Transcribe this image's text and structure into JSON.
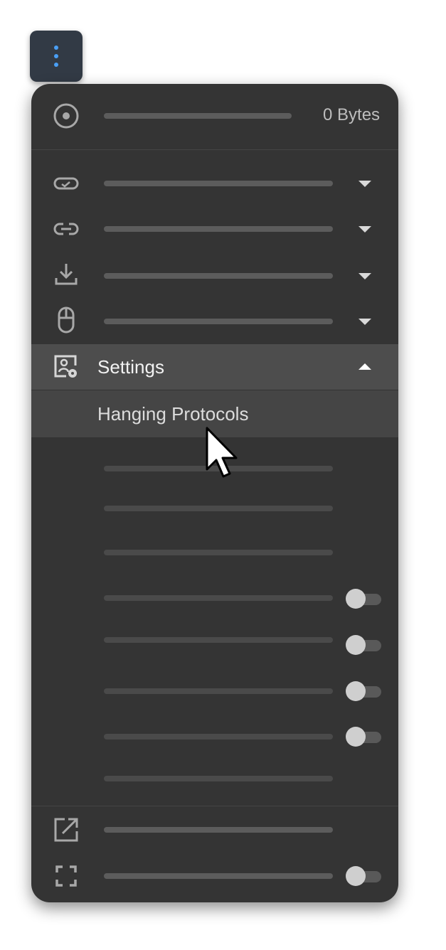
{
  "storage": {
    "usage_text": "0 Bytes",
    "icon": "disc-icon"
  },
  "menu_items": [
    {
      "icon": "tag-check-icon",
      "expanded": false
    },
    {
      "icon": "link-icon",
      "expanded": false
    },
    {
      "icon": "download-icon",
      "expanded": false
    },
    {
      "icon": "mouse-icon",
      "expanded": false
    }
  ],
  "settings": {
    "label": "Settings",
    "icon": "settings-image-icon",
    "expanded": true,
    "submenu": {
      "active_item": "Hanging Protocols"
    }
  },
  "setting_toggles": [
    false,
    false,
    false,
    false
  ],
  "footer": [
    {
      "icon": "open-external-icon"
    },
    {
      "icon": "fullscreen-icon",
      "toggle": false
    }
  ],
  "colors": {
    "panel": "#343434",
    "highlight": "#4d4d4d",
    "accent_dots": "#4a9ff5",
    "trigger_button": "#323a45"
  }
}
